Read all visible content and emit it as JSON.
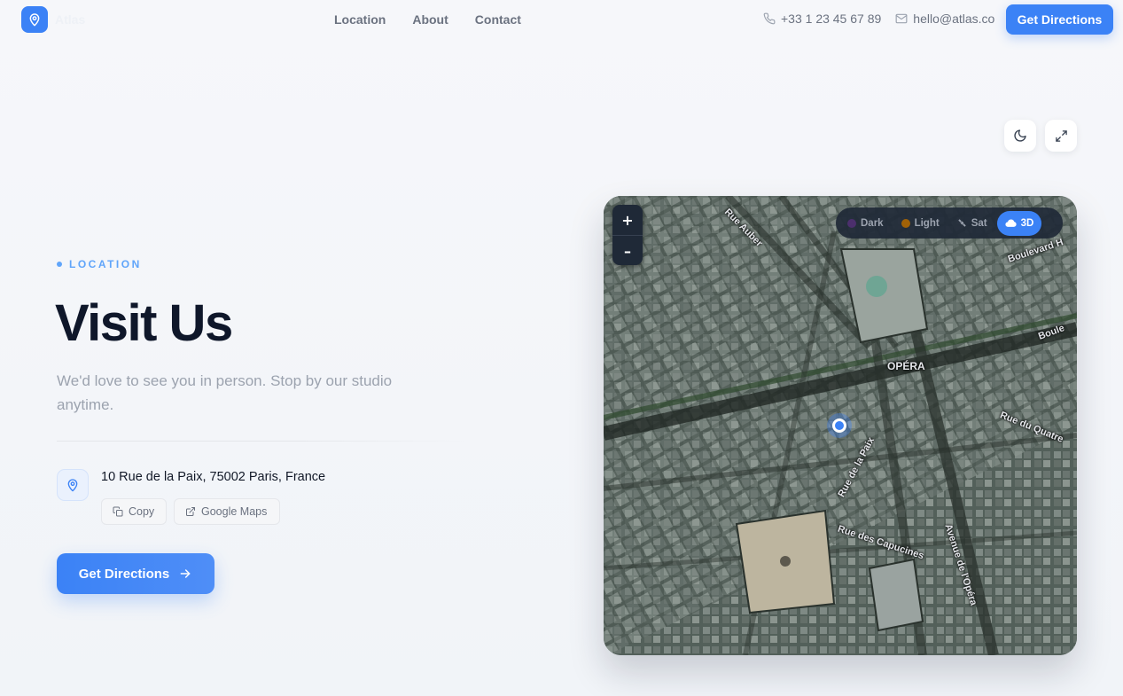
{
  "header": {
    "brand": "Atlas",
    "nav": [
      "Location",
      "About",
      "Contact"
    ],
    "phone": "+33 1 23 45 67 89",
    "email": "hello@atlas.co",
    "cta_label": "Get Directions"
  },
  "tools": {
    "theme_icon": "moon-icon",
    "expand_icon": "expand-icon"
  },
  "hero": {
    "eyebrow": "LOCATION",
    "title": "Visit Us",
    "subtitle": "We'd love to see you in person. Stop by our studio anytime.",
    "address": "10 Rue de la Paix, 75002 Paris, France",
    "copy_label": "Copy",
    "maps_label": "Google Maps",
    "cta_label": "Get Directions"
  },
  "map": {
    "zoom_in": "+",
    "zoom_out": "–",
    "styles": [
      {
        "label": "Dark",
        "active": false
      },
      {
        "label": "Light",
        "active": false
      },
      {
        "label": "Sat",
        "active": false
      },
      {
        "label": "3D",
        "active": true
      }
    ],
    "labels": {
      "opera": "OPÉRA",
      "boulevard_top": "Boulevard H",
      "boulevard_right": "Boule",
      "rue_quatre": "Rue du Quatre",
      "rue_auber": "Rue Auber",
      "rue_paix": "Rue de la Paix",
      "avenue_opera": "Avenue de l'Opéra",
      "rue_capucines": "Rue des Capucines"
    }
  },
  "colors": {
    "accent": "#3b82f6",
    "eyebrow": "#60a5fa",
    "text_primary": "#0f172a",
    "text_muted": "#9ca3af"
  }
}
